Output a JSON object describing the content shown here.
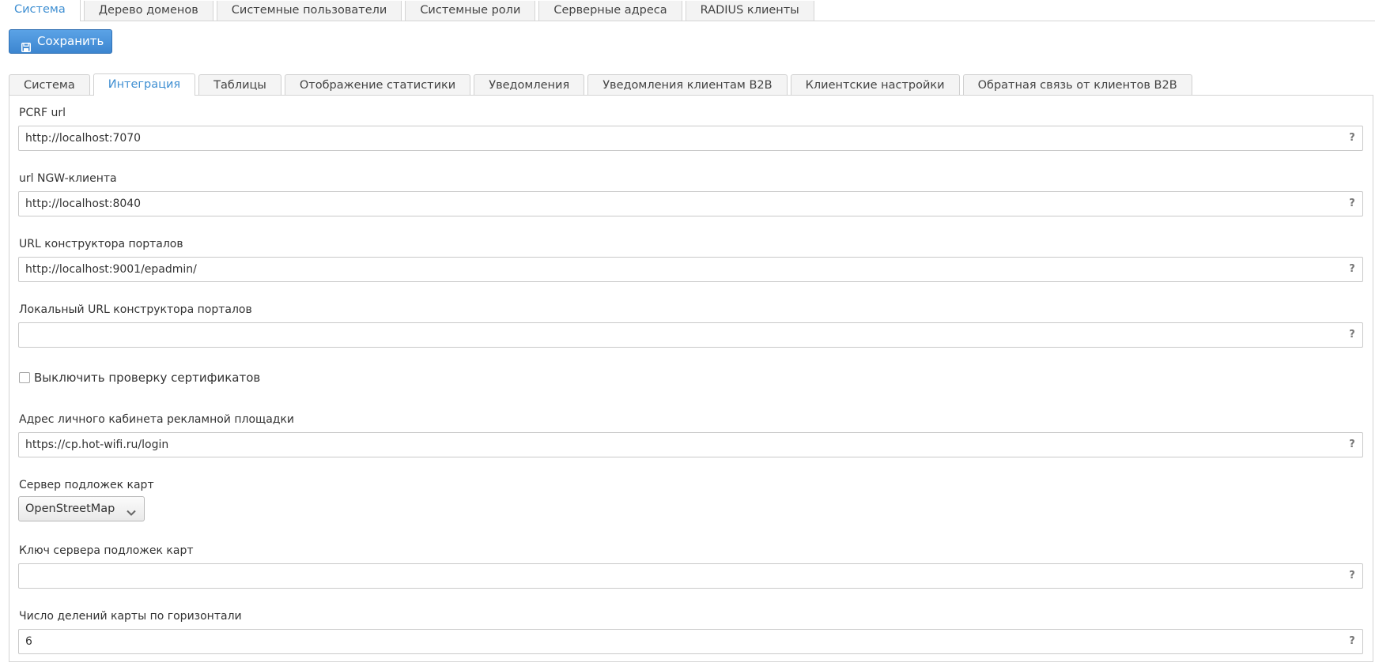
{
  "top_tabs": [
    {
      "label": "Система",
      "active": true
    },
    {
      "label": "Дерево доменов",
      "active": false
    },
    {
      "label": "Системные пользователи",
      "active": false
    },
    {
      "label": "Системные роли",
      "active": false
    },
    {
      "label": "Серверные адреса",
      "active": false
    },
    {
      "label": "RADIUS клиенты",
      "active": false
    }
  ],
  "toolbar": {
    "save_label": "Сохранить",
    "save_icon": "floppy-disk-icon"
  },
  "sub_tabs": [
    {
      "label": "Система",
      "active": false
    },
    {
      "label": "Интеграция",
      "active": true
    },
    {
      "label": "Таблицы",
      "active": false
    },
    {
      "label": "Отображение статистики",
      "active": false
    },
    {
      "label": "Уведомления",
      "active": false
    },
    {
      "label": "Уведомления клиентам B2B",
      "active": false
    },
    {
      "label": "Клиентские настройки",
      "active": false
    },
    {
      "label": "Обратная связь от клиентов B2B",
      "active": false
    }
  ],
  "form": {
    "pcrf_url": {
      "label": "PCRF url",
      "value": "http://localhost:7070"
    },
    "ngw_url": {
      "label": "url NGW-клиента",
      "value": "http://localhost:8040"
    },
    "portal_builder_url": {
      "label": "URL конструктора порталов",
      "value": "http://localhost:9001/epadmin/"
    },
    "local_portal_builder_url": {
      "label": "Локальный URL конструктора порталов",
      "value": ""
    },
    "disable_cert_check": {
      "label": "Выключить проверку сертификатов",
      "checked": false
    },
    "ad_cabinet_url": {
      "label": "Адрес личного кабинета рекламной площадки",
      "value": "https://cp.hot-wifi.ru/login"
    },
    "map_tile_server": {
      "label": "Сервер подложек карт",
      "value": "OpenStreetMap"
    },
    "map_tile_key": {
      "label": "Ключ сервера подложек карт",
      "value": ""
    },
    "map_h_divisions": {
      "label": "Число делений карты по горизонтали",
      "value": "6"
    },
    "help_glyph": "?"
  },
  "colors": {
    "accent": "#3f8fd2",
    "button_bg": "#4a94dc"
  }
}
